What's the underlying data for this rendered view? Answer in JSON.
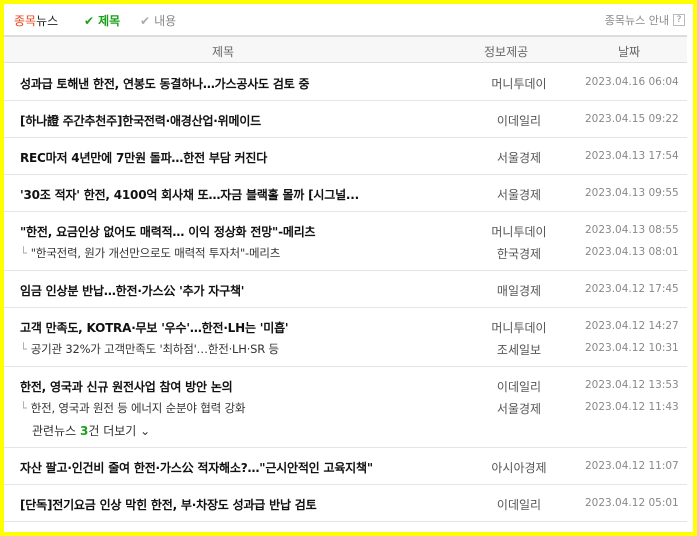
{
  "header": {
    "tab_highlight": "종목",
    "tab_rest": "뉴스",
    "filter_title": "제목",
    "filter_content": "내용",
    "guide": "종목뉴스 안내",
    "guide_q": "?"
  },
  "columns": {
    "title": "제목",
    "source": "정보제공",
    "date": "날짜"
  },
  "groups": [
    {
      "rows": [
        {
          "title": "성과급 토해낸 한전, 연봉도 동결하나…가스공사도 검토 중",
          "source": "머니투데이",
          "date": "2023.04.16 06:04"
        }
      ]
    },
    {
      "rows": [
        {
          "title": "[하나證 주간추천주]한국전력·애경산업·위메이드",
          "source": "이데일리",
          "date": "2023.04.15 09:22"
        }
      ]
    },
    {
      "rows": [
        {
          "title": "REC마저 4년만에 7만원 돌파…한전 부담 커진다",
          "source": "서울경제",
          "date": "2023.04.13 17:54"
        }
      ]
    },
    {
      "rows": [
        {
          "title": "'30조 적자' 한전, 4100억 회사채 또…자금 블랙홀 몰까 [시그널...",
          "source": "서울경제",
          "date": "2023.04.13 09:55"
        }
      ]
    },
    {
      "rows": [
        {
          "title": "\"한전, 요금인상 없어도 매력적… 이익 정상화 전망\"-메리츠",
          "source": "머니투데이",
          "date": "2023.04.13 08:55"
        },
        {
          "title": "\"한국전력, 원가 개선만으로도 매력적 투자처\"-메리츠",
          "source": "한국경제",
          "date": "2023.04.13 08:01",
          "sub": true
        }
      ]
    },
    {
      "rows": [
        {
          "title": "임금 인상분 반납…한전·가스公 '추가 자구책'",
          "source": "매일경제",
          "date": "2023.04.12 17:45"
        }
      ]
    },
    {
      "rows": [
        {
          "title": "고객 만족도, KOTRA·무보 '우수'…한전·LH는 '미흡'",
          "source": "머니투데이",
          "date": "2023.04.12 14:27"
        },
        {
          "title": "공기관 32%가 고객만족도 '최하점'…한전·LH·SR 등",
          "source": "조세일보",
          "date": "2023.04.12 10:31",
          "sub": true
        }
      ]
    },
    {
      "rows": [
        {
          "title": "한전, 영국과 신규 원전사업 참여 방안 논의",
          "source": "이데일리",
          "date": "2023.04.12 13:53"
        },
        {
          "title": "한전, 영국과 원전 등 에너지 순분야 협력 강화",
          "source": "서울경제",
          "date": "2023.04.12 11:43",
          "sub": true
        }
      ],
      "more": {
        "prefix": "관련뉴스 ",
        "count": "3",
        "suffix": "건 더보기"
      }
    },
    {
      "rows": [
        {
          "title": "자산 팔고·인건비 줄여 한전·가스公 적자해소?…\"근시안적인 고육지책\"",
          "source": "아시아경제",
          "date": "2023.04.12 11:07"
        }
      ]
    },
    {
      "rows": [
        {
          "title": "[단독]전기요금 인상 막힌 한전, 부·차장도 성과급 반납 검토",
          "source": "이데일리",
          "date": "2023.04.12 05:01"
        }
      ]
    }
  ],
  "colors": {
    "highlight": "#e8481e",
    "check_on": "#1aa01a",
    "frame": "#ffff00"
  }
}
